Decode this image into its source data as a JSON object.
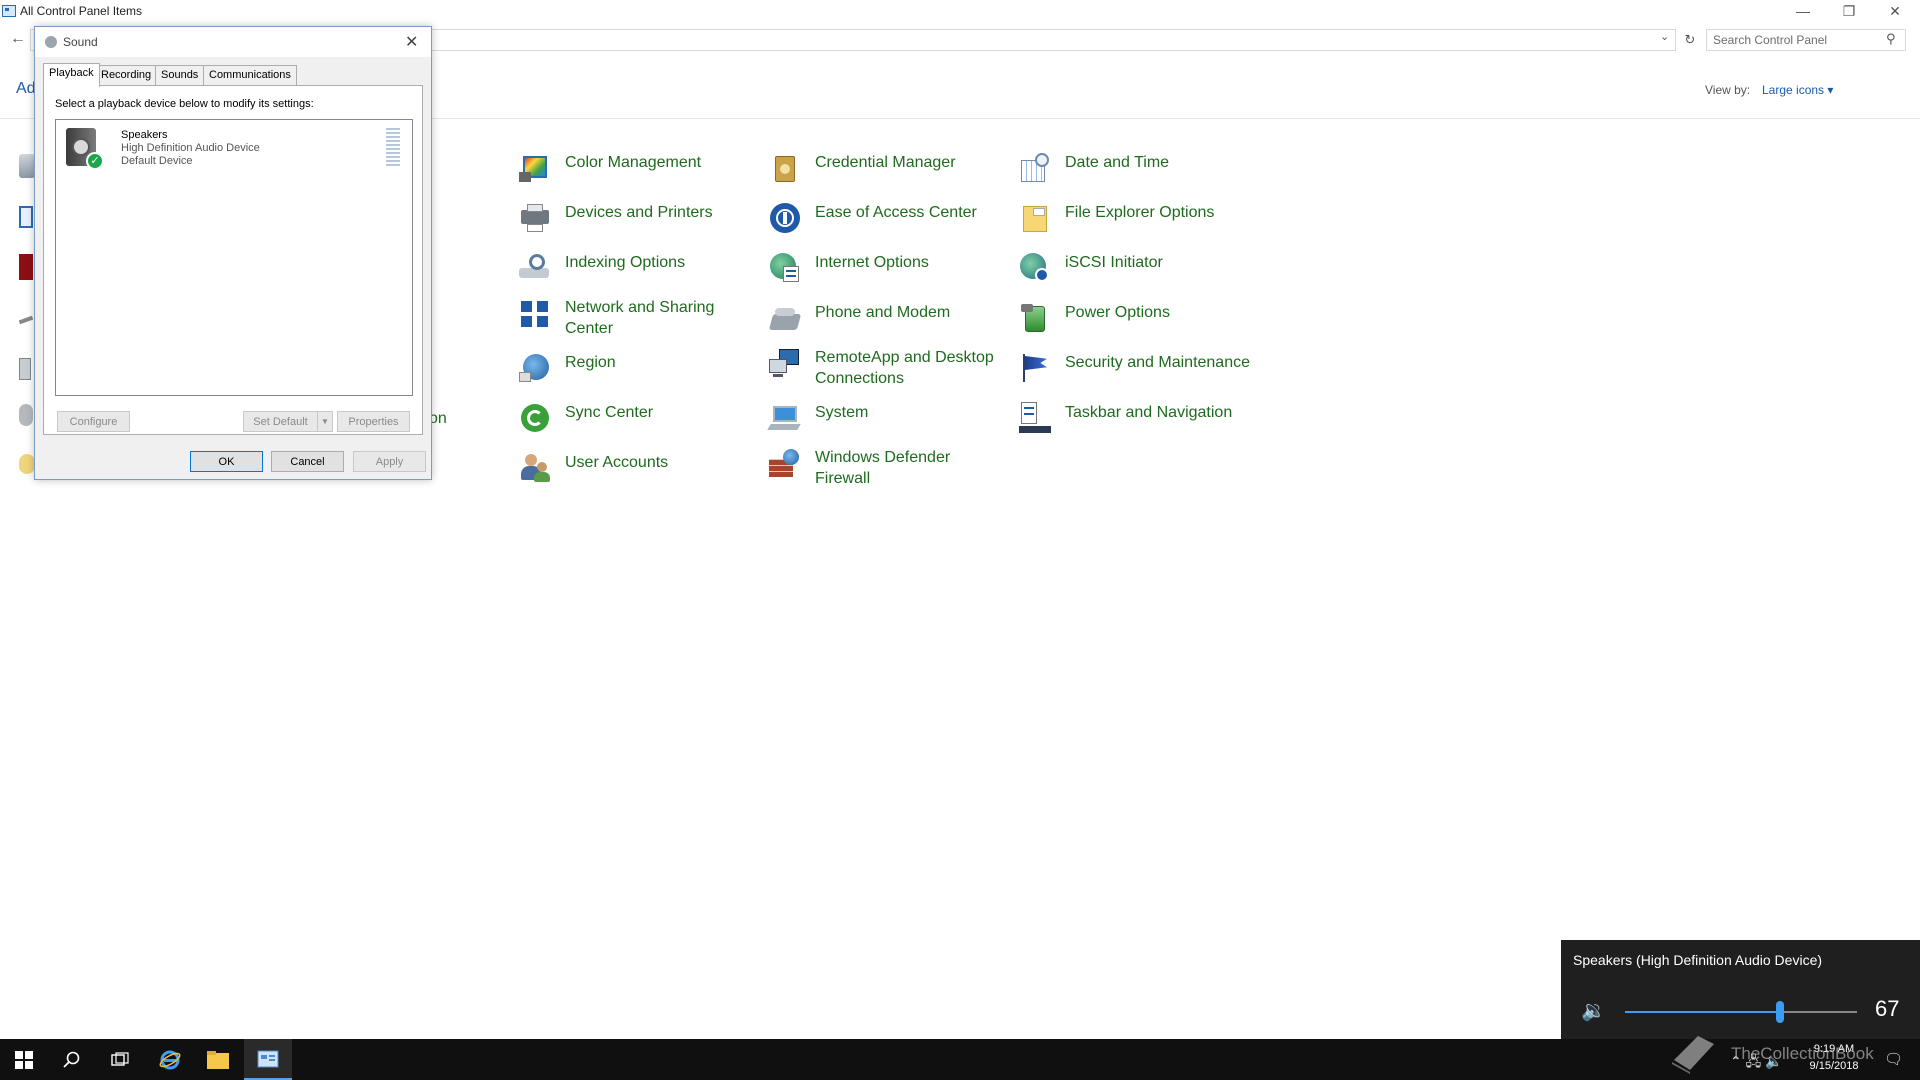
{
  "window": {
    "title": "All Control Panel Items",
    "minimize": "—",
    "restore": "❐",
    "close": "✕"
  },
  "toolbar": {
    "back": "←",
    "search_placeholder": "Search Control Panel",
    "adjust_partial": "Ad",
    "view_by_label": "View by:",
    "view_by_value": "Large icons ▾"
  },
  "partial_label": "on",
  "items": [
    {
      "label": "Color Management",
      "icon": "color-management-icon"
    },
    {
      "label": "Credential Manager",
      "icon": "credential-manager-icon"
    },
    {
      "label": "Date and Time",
      "icon": "date-time-icon"
    },
    {
      "label": "Devices and Printers",
      "icon": "devices-printers-icon"
    },
    {
      "label": "Ease of Access Center",
      "icon": "ease-of-access-icon"
    },
    {
      "label": "File Explorer Options",
      "icon": "file-explorer-options-icon"
    },
    {
      "label": "Indexing Options",
      "icon": "indexing-options-icon"
    },
    {
      "label": "Internet Options",
      "icon": "internet-options-icon"
    },
    {
      "label": "iSCSI Initiator",
      "icon": "iscsi-initiator-icon"
    },
    {
      "label": "Network and Sharing Center",
      "icon": "network-sharing-icon"
    },
    {
      "label": "Phone and Modem",
      "icon": "phone-modem-icon"
    },
    {
      "label": "Power Options",
      "icon": "power-options-icon"
    },
    {
      "label": "Region",
      "icon": "region-icon"
    },
    {
      "label": "RemoteApp and Desktop Connections",
      "icon": "remoteapp-icon"
    },
    {
      "label": "Security and Maintenance",
      "icon": "security-maintenance-icon"
    },
    {
      "label": "Sync Center",
      "icon": "sync-center-icon"
    },
    {
      "label": "System",
      "icon": "system-icon"
    },
    {
      "label": "Taskbar and Navigation",
      "icon": "taskbar-navigation-icon"
    },
    {
      "label": "User Accounts",
      "icon": "user-accounts-icon"
    },
    {
      "label": "Windows Defender Firewall",
      "icon": "firewall-icon"
    }
  ],
  "sound_dialog": {
    "title": "Sound",
    "tabs": [
      "Playback",
      "Recording",
      "Sounds",
      "Communications"
    ],
    "active_tab": "Playback",
    "instructions": "Select a playback device below to modify its settings:",
    "device": {
      "name": "Speakers",
      "description": "High Definition Audio Device",
      "status": "Default Device"
    },
    "buttons": {
      "configure": "Configure",
      "set_default": "Set Default",
      "properties": "Properties",
      "ok": "OK",
      "cancel": "Cancel",
      "apply": "Apply"
    }
  },
  "volume_flyout": {
    "device": "Speakers (High Definition Audio Device)",
    "level": 67
  },
  "taskbar": {
    "time": "9:19 AM",
    "date": "9/15/2018",
    "watermark": "TheCollectionBook"
  },
  "colors": {
    "link_green": "#1e6b1e",
    "accent_blue": "#0078d7",
    "flyout_bg": "#1f1f1f",
    "taskbar_bg": "#101010"
  }
}
